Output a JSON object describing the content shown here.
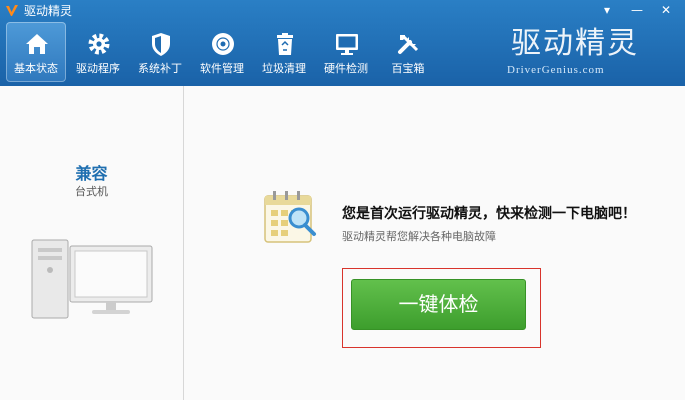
{
  "window": {
    "title": "驱动精灵",
    "controls": {
      "menu": "▾",
      "minimize": "—",
      "close": "✕"
    }
  },
  "toolbar": {
    "items": [
      {
        "label": "基本状态",
        "icon": "home-icon",
        "active": true
      },
      {
        "label": "驱动程序",
        "icon": "gear-icon",
        "active": false
      },
      {
        "label": "系统补丁",
        "icon": "shield-icon",
        "active": false
      },
      {
        "label": "软件管理",
        "icon": "disc-icon",
        "active": false
      },
      {
        "label": "垃圾清理",
        "icon": "recycle-bin-icon",
        "active": false
      },
      {
        "label": "硬件检测",
        "icon": "monitor-icon",
        "active": false
      },
      {
        "label": "百宝箱",
        "icon": "tools-icon",
        "active": false
      }
    ]
  },
  "brand": {
    "logo_text": "驱动精灵",
    "url_text": "DriverGenius.com"
  },
  "device": {
    "name": "兼容",
    "type": "台式机"
  },
  "main": {
    "headline": "您是首次运行驱动精灵，快来检测一下电脑吧！",
    "subline": "驱动精灵帮您解决各种电脑故障",
    "check_button": "一键体检"
  },
  "colors": {
    "toolbar": "#1f6cb2",
    "accent": "#1f6fb0",
    "button": "#4fb13b",
    "highlight": "#d8342c"
  }
}
